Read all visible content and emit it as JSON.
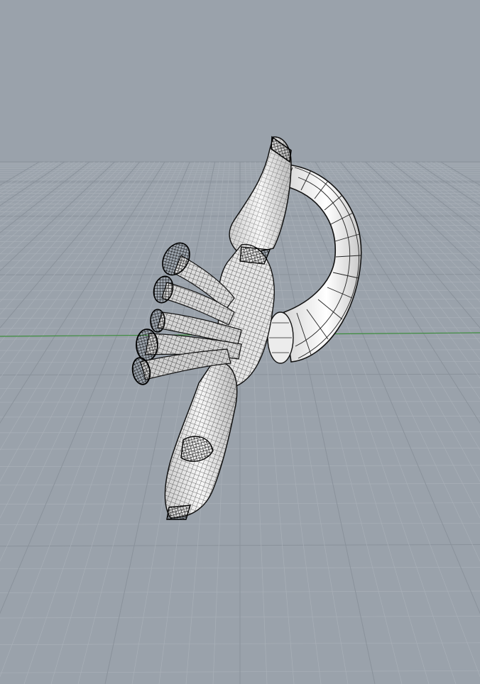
{
  "viewport": {
    "background": "#9aa2ab",
    "grid": {
      "visible": true,
      "minor_color": "#a9b0b8",
      "major_color": "#8a929b",
      "x_axis_color": "#3c8c3c"
    },
    "model": {
      "display_mode": "wireframe-shaded",
      "surface_color": "#f2f2f2",
      "wire_color": "#111111",
      "objects": [
        "ring-handle",
        "leaf-stem-upper",
        "leaf-stem-lower",
        "flower-buds"
      ]
    }
  }
}
